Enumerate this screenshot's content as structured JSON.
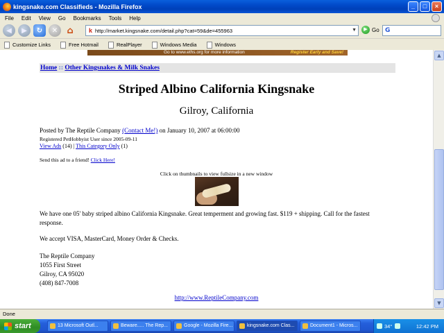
{
  "window": {
    "title": "kingsnake.com Classifieds - Mozilla Firefox",
    "buttons": [
      "_",
      "□",
      "×"
    ]
  },
  "menu": [
    "File",
    "Edit",
    "View",
    "Go",
    "Bookmarks",
    "Tools",
    "Help"
  ],
  "toolbar": {
    "url": "http://market.kingsnake.com/detail.php?cat=59&de=455963",
    "go_label": "Go",
    "search_engine_icon": "google-g-icon"
  },
  "bookmarks": [
    "Customize Links",
    "Free Hotmail",
    "RealPlayer",
    "Windows Media",
    "Windows"
  ],
  "banner": {
    "left_text": "Go to www.eths.org for more information",
    "right_text": "Register Early and Save!"
  },
  "page": {
    "breadcrumb_home": "Home",
    "breadcrumb_sep": "::",
    "breadcrumb_category": "Other Kingsnakes & Milk Snakes",
    "title": "Striped Albino California Kingsnake",
    "location": "Gilroy, California",
    "posted_prefix": "Posted by The Reptile Company",
    "contact_link": "(Contact Me!)",
    "posted_suffix": "on January 10, 2007 at 06:00:00",
    "registered": "Registered PetHobbyist User since 2005-09-11",
    "view_ads_link": "View Ads",
    "view_ads_count": "(14)",
    "category_only_link": "This Category Only",
    "category_count": "(1)",
    "send_prefix": "Send this ad to a friend!",
    "send_link": "Click Here!",
    "thumb_note": "Click on thumbnails to view fullsize in a new window",
    "description": "We have one 05' baby striped albino California Kingsnake. Great temperment and growing fast. $119 + shipping. Call for the fastest response.",
    "accept": "We accept VISA, MasterCard, Money Order & Checks.",
    "address": [
      "The Reptile Company",
      "1055 First Street",
      "Gilroy, CA 95020",
      "(408) 847-7008"
    ],
    "website_link": "http://www.ReptileCompany.com"
  },
  "status": "Done",
  "taskbar": {
    "start_label": "start",
    "tasks": [
      "13 Microsoft Outl...",
      "Beware..... The Rep...",
      "Google - Mozilla Fire...",
      "kingsnake.com Clas...",
      "Document1 - Micros..."
    ],
    "active_task_index": 3,
    "tray_temp": "34°",
    "clock": "12:42 PM"
  }
}
